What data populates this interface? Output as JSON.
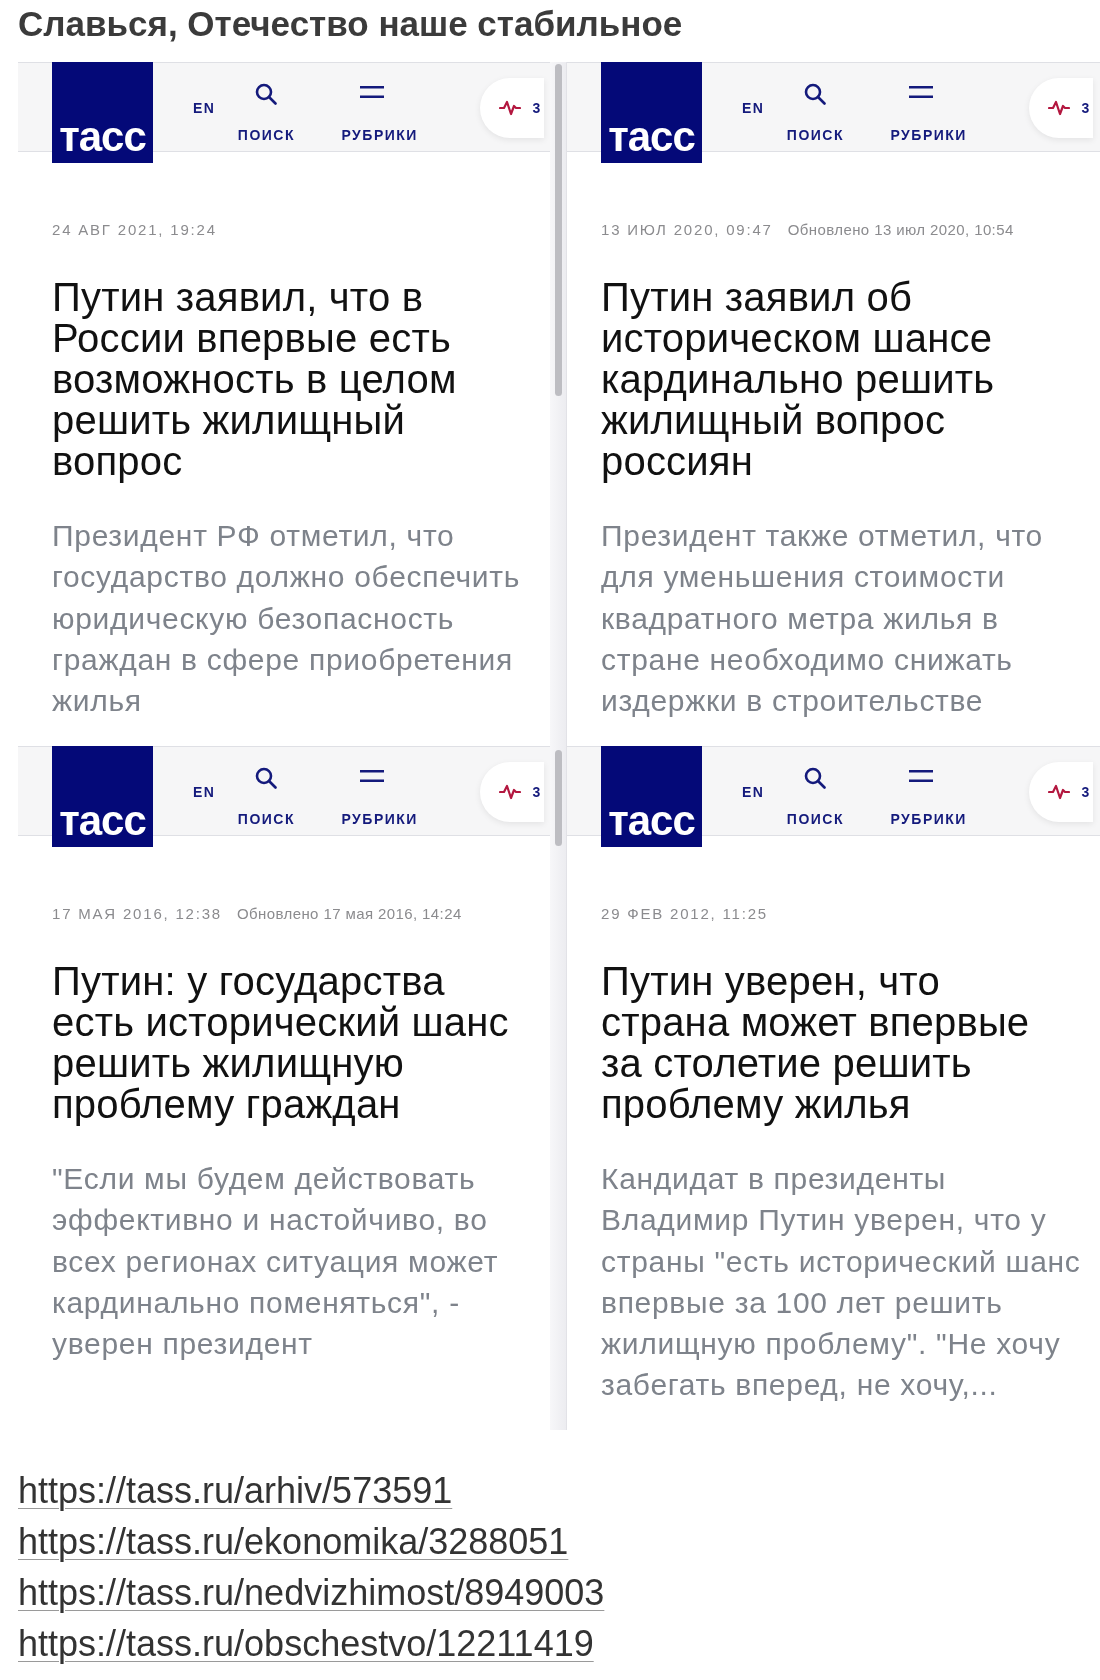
{
  "title": "Славься, Отечество наше стабильное",
  "screenshots": [
    {
      "header": {
        "logo": "тасс",
        "language": "EN",
        "search": "ПОИСК",
        "rubrics": "РУБРИКИ",
        "counter": "3"
      },
      "date": "24 АВГ 2021, 19:24",
      "headline": "Путин заявил, что в России впервые есть возможность в целом решить жилищный вопрос",
      "summary": "Президент РФ отметил, что государство должно обеспечить юридическую безопасность граждан в сфере приобретения жилья"
    },
    {
      "header": {
        "logo": "тасс",
        "language": "EN",
        "search": "ПОИСК",
        "rubrics": "РУБРИКИ",
        "counter": "3"
      },
      "date": "13 ИЮЛ 2020, 09:47",
      "updated": "Обновлено 13 июл 2020, 10:54",
      "headline": "Путин заявил об историческом шансе кардинально решить жилищный вопрос россиян",
      "summary": "Президент также отметил, что для уменьшения стоимости квадратного метра жилья в стране необходимо снижать издержки в строительстве"
    },
    {
      "header": {
        "logo": "тасс",
        "language": "EN",
        "search": "ПОИСК",
        "rubrics": "РУБРИКИ",
        "counter": "3"
      },
      "date": "17 МАЯ 2016, 12:38",
      "updated": "Обновлено 17 мая 2016, 14:24",
      "headline": "Путин: у государства есть исторический шанс решить жилищную проблему граждан",
      "summary": "\"Если мы будем действовать эффективно и настойчиво, во всех регионах ситуация может кардинально поменяться\", - уверен президент"
    },
    {
      "header": {
        "logo": "тасс",
        "language": "EN",
        "search": "ПОИСК",
        "rubrics": "РУБРИКИ",
        "counter": "3"
      },
      "date": "29 ФЕВ 2012, 11:25",
      "headline": "Путин уверен, что страна может впервые за столетие решить проблему жилья",
      "summary": "Кандидат в президенты Владимир Путин уверен, что у страны \"есть исторический шанс впервые за 100 лет решить жилищную проблему\". \"Не хочу забегать вперед, не хочу,..."
    }
  ],
  "links": [
    "https://tass.ru/arhiv/573591",
    "https://tass.ru/ekonomika/3288051",
    "https://tass.ru/nedvizhimost/8949003",
    "https://tass.ru/obschestvo/12211419"
  ]
}
